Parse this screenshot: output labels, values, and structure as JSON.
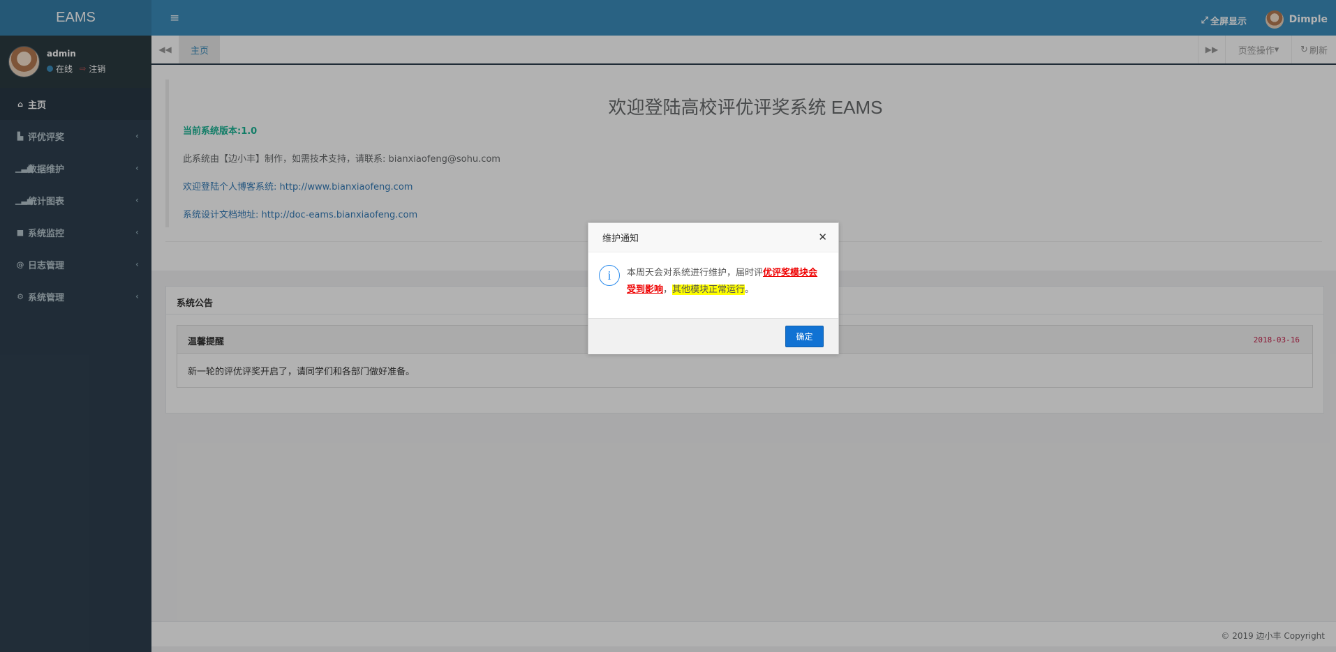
{
  "app": {
    "logo": "EAMS"
  },
  "user_panel": {
    "name": "admin",
    "online": "在线",
    "logout": "注销"
  },
  "sidebar": {
    "items": [
      {
        "label": "主页",
        "icon": "home-icon"
      },
      {
        "label": "评优评奖",
        "icon": "flag-icon"
      },
      {
        "label": "数据维护",
        "icon": "bar-chart-icon"
      },
      {
        "label": "统计图表",
        "icon": "bar-chart-icon"
      },
      {
        "label": "系统监控",
        "icon": "video-camera-icon"
      },
      {
        "label": "日志管理",
        "icon": "at-icon"
      },
      {
        "label": "系统管理",
        "icon": "gear-icon"
      }
    ]
  },
  "topbar": {
    "fullscreen": "全屏显示",
    "username": "Dimple"
  },
  "tabs": {
    "home": "主页",
    "ops": "页签操作",
    "refresh": "刷新"
  },
  "welcome": {
    "title": "欢迎登陆高校评优评奖系统 EAMS",
    "version": "当前系统版本:1.0",
    "line1": "此系统由【边小丰】制作，如需技术支持，请联系: bianxiaofeng@sohu.com",
    "line2": "欢迎登陆个人博客系统: http://www.bianxiaofeng.com",
    "line3": "系统设计文档地址: http://doc-eams.bianxiaofeng.com"
  },
  "notice": {
    "panel_title": "系统公告",
    "card_title": "温馨提醒",
    "date": "2018-03-16",
    "body": "新一轮的评优评奖开启了，请同学们和各部门做好准备。"
  },
  "footer": {
    "copyright": "© 2019 边小丰 Copyright"
  },
  "dialog": {
    "title": "维护通知",
    "text_before": "本周天会对系统进行维护，届时评",
    "text_red": "优评奖模块会受到影响",
    "text_comma": "，",
    "text_yellow": "其他模块正常运行",
    "text_end": "。",
    "ok": "确定"
  }
}
